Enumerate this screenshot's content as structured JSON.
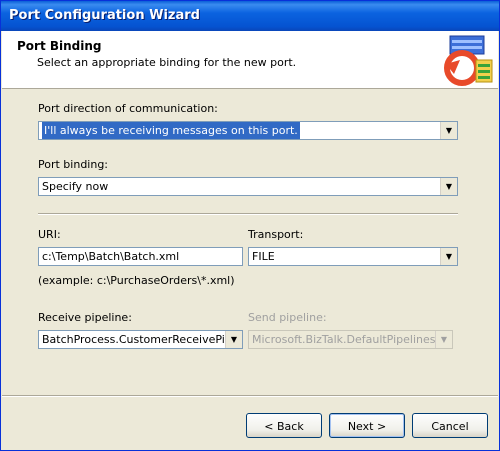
{
  "window": {
    "title": "Port Configuration Wizard"
  },
  "header": {
    "title": "Port Binding",
    "subtitle": "Select an appropriate binding for the new port."
  },
  "direction": {
    "label": "Port direction of communication:",
    "value": "I'll always be receiving messages on this port."
  },
  "binding": {
    "label": "Port binding:",
    "value": "Specify now"
  },
  "uri": {
    "label": "URI:",
    "value": "c:\\Temp\\Batch\\Batch.xml",
    "example": "(example: c:\\PurchaseOrders\\*.xml)"
  },
  "transport": {
    "label": "Transport:",
    "value": "FILE"
  },
  "receive_pipeline": {
    "label": "Receive pipeline:",
    "value": "BatchProcess.CustomerReceivePipeline"
  },
  "send_pipeline": {
    "label": "Send pipeline:",
    "value": "Microsoft.BizTalk.DefaultPipelines.XMLTransmit"
  },
  "buttons": {
    "back": "< Back",
    "next": "Next >",
    "cancel": "Cancel"
  }
}
